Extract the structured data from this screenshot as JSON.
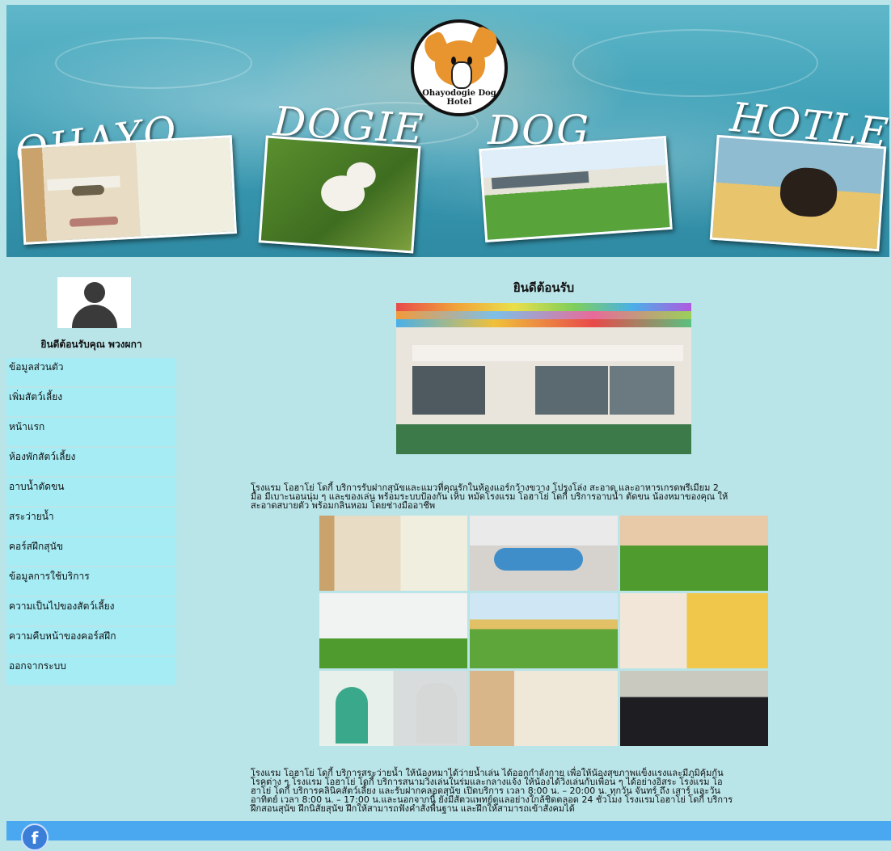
{
  "banner": {
    "logo_text": "Ohayodogie Dog Hotel",
    "words": [
      "OHAYO",
      "DOGIE",
      "DOG",
      "HOTLE"
    ]
  },
  "sidebar": {
    "welcome": "ยินดีต้อนรับคุณ พวงผกา",
    "items": [
      {
        "label": "ข้อมูลส่วนตัว"
      },
      {
        "label": "เพิ่มสัตว์เลี้ยง"
      },
      {
        "label": "หน้าแรก"
      },
      {
        "label": "ห้องพักสัตว์เลี้ยง"
      },
      {
        "label": "อาบน้ำตัดขน"
      },
      {
        "label": "สระว่ายน้ำ"
      },
      {
        "label": "คอร์สฝึกสุนัข"
      },
      {
        "label": "ข้อมูลการใช้บริการ"
      },
      {
        "label": "ความเป็นไปของสัตว์เลี้ยง"
      },
      {
        "label": "ความคืบหน้าของคอร์สฝึก"
      },
      {
        "label": "ออกจากระบบ"
      }
    ]
  },
  "main": {
    "title": "ยินดีต้อนรับ",
    "para1": [
      "โรงแรม โอฮาโย่ โดกี้ บริการรับฝากสุนัขและแมวที่คุณรักในห้องแอร์กว้างขวาง โปรงโล่ง สะอาด และอาหารเกรดพรีเมียม 2",
      "มื้อ มีเบาะนอนนุ่ม ๆ และของเล่น พร้อมระบบป้องกัน เห็บ หมัดโรงแรม โอฮาโย่ โดกี้ บริการอาบน้ำ ตัดขน น้องหมาของคุณ ให้",
      "สะอาดสบายตัว พร้อมกลิ่นหอม โดยช่างมืออาชีพ"
    ],
    "para2": [
      "โรงแรม โอฮาโย่ โดกี้ บริการสระว่ายน้ำ ให้น้องหมาได้ว่ายน้ำเล่น ได้ออกกำลังกาย เพื่อให้น้องสุขภาพแข็งแรงและมีภูมิคุ้มกัน",
      "โรคต่าง ๆ โรงแรม โอฮาโย่ โดกี้ บริการสนามวิ่งเล่นในร่มและกลางแจ้ง ให้น้องได้วิ่งเล่นกับเพื่อน ๆ ได้อย่างอิสระ โรงแรม โอ",
      "ฮาโย่ โดกี้ บริการคลินิคสัตว์เลี้ยง และรับฝากคลอดสุนัข เปิดบริการ เวลา 8:00 น. – 20:00 น. ทุกวัน จันทร์ ถึง เสาร์ และวัน",
      "อาทิตย์ เวลา 8:00 น. – 17:00 น.และนอกจากนี้ ยังมีสัตวแพทย์ดูแลอย่างใกล้ชิดตลอด 24 ชั่วโมง โรงแรมโอฮาโย่ โดกี้ บริการ",
      "ฝึกสอนสุนัข ฝึกนิสัยสุนัข ฝึกให้สามารถฟังคำสั่งพื้นฐาน และฝึกให้สามารถเข้าสังคมได้"
    ]
  },
  "footer": {
    "fb": "f"
  }
}
